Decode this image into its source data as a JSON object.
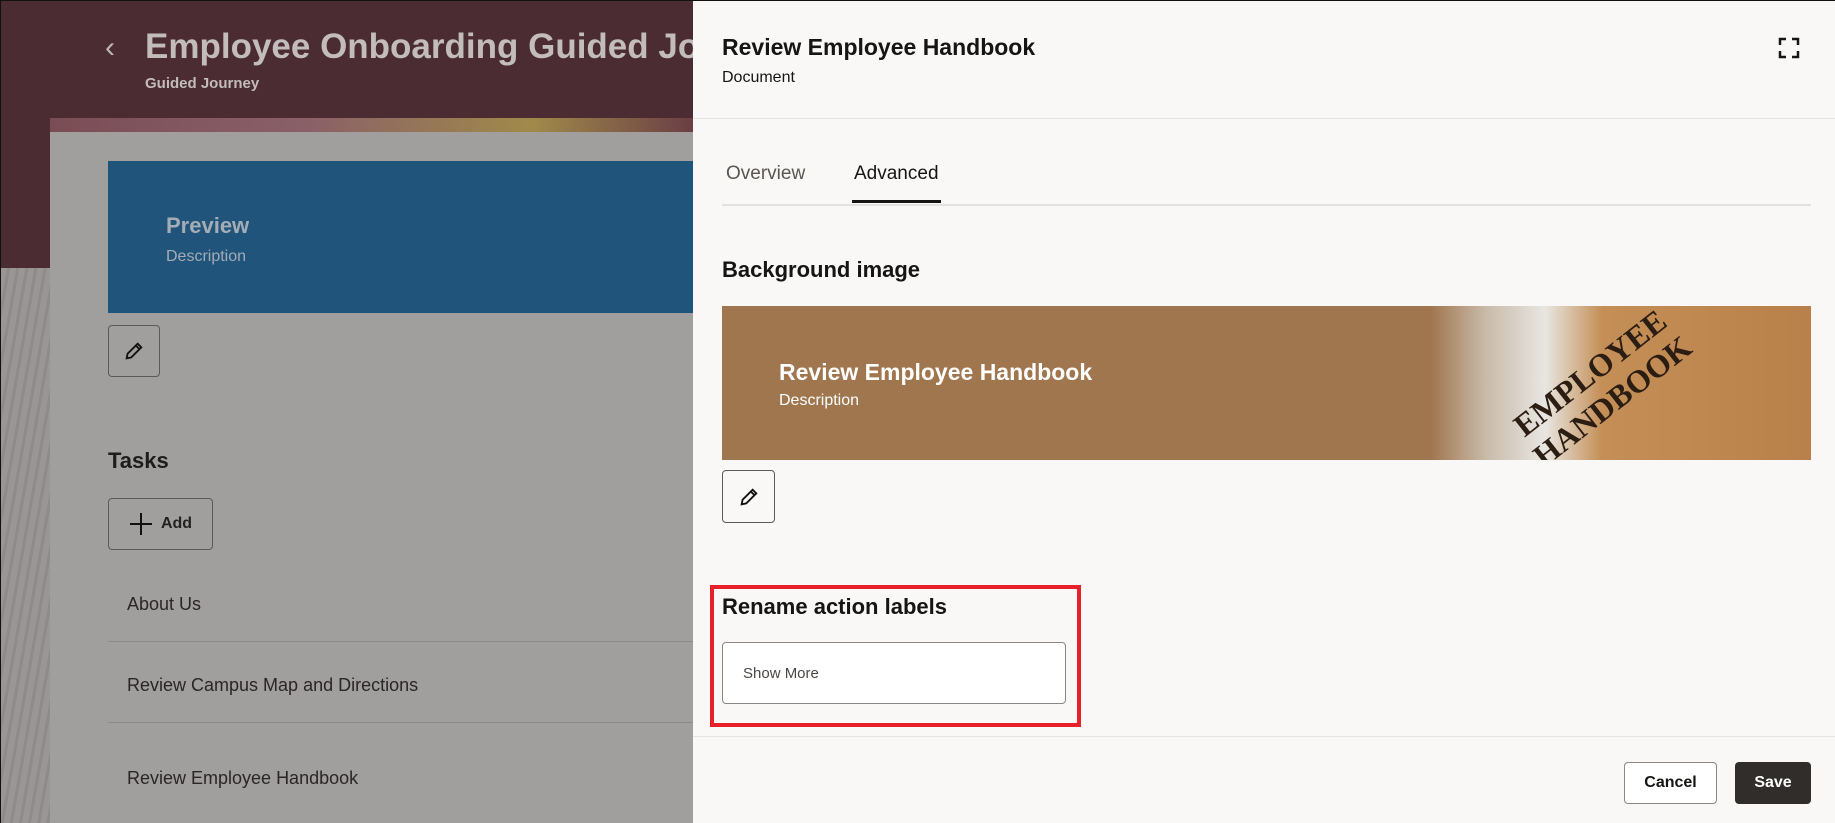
{
  "background_page": {
    "title": "Employee Onboarding Guided Jou",
    "subtitle": "Guided Journey",
    "preview": {
      "title": "Preview",
      "description": "Description"
    },
    "tasks_heading": "Tasks",
    "add_label": "Add",
    "tasks": [
      "About Us",
      "Review Campus Map and Directions",
      "Review Employee Handbook"
    ]
  },
  "panel": {
    "title": "Review Employee Handbook",
    "subtitle": "Document",
    "tabs": [
      {
        "label": "Overview",
        "selected": false
      },
      {
        "label": "Advanced",
        "selected": true
      }
    ],
    "background_section": "Background image",
    "banner": {
      "title": "Review Employee Handbook",
      "description": "Description",
      "image_text": "EMPLOYEE HANDBOOK"
    },
    "rename_section": "Rename action labels",
    "show_more": "Show More",
    "cancel_label": "Cancel",
    "save_label": "Save"
  },
  "colors": {
    "header": "#4a2c32",
    "preview": "#20547a",
    "banner": "#a0764f",
    "highlight": "#e8202a",
    "save": "#312d2a"
  }
}
